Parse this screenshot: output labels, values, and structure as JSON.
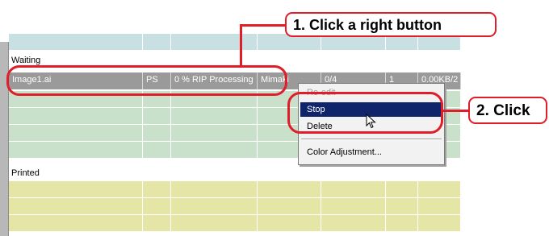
{
  "sections": {
    "waiting_label": "Waiting",
    "printed_label": "Printed"
  },
  "job_row": {
    "file": "Image1.ai",
    "type": "PS",
    "status": "0 % RIP Processing",
    "printer": "Mimaki",
    "pages": "0/4",
    "copies": "1",
    "size": "0.00KB/2"
  },
  "context_menu": {
    "items": [
      {
        "label": "Re-edit",
        "enabled": false
      },
      {
        "label": "Stop",
        "enabled": true,
        "highlighted": true
      },
      {
        "label": "Delete",
        "enabled": true
      },
      {
        "label": "Color Adjustment...",
        "enabled": true
      }
    ]
  },
  "annotations": {
    "step1": "1. Click a right button",
    "step2": "2. Click"
  },
  "colors": {
    "annotation_red": "#e01d28",
    "menu_highlight": "#10246b",
    "selected_row": "#9a9a9a",
    "waiting_rows": "#c9e1ca",
    "printed_rows": "#e5e6a5",
    "top_rows": "#c9e0e3"
  },
  "icons": {
    "cursor": "arrow-pointer-icon"
  }
}
